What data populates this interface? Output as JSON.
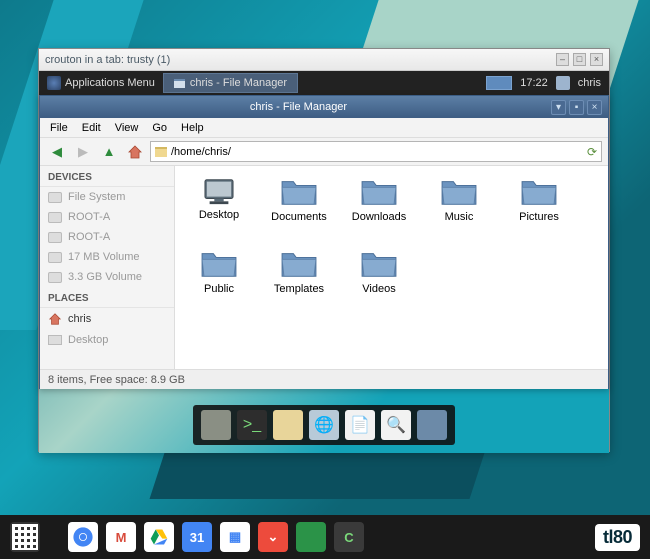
{
  "outer_window": {
    "title": "crouton in a tab: trusty (1)"
  },
  "panel": {
    "appmenu": "Applications Menu",
    "task": "chris - File Manager",
    "clock": "17:22",
    "user": "chris"
  },
  "filemanager": {
    "title": "chris - File Manager",
    "menus": [
      "File",
      "Edit",
      "View",
      "Go",
      "Help"
    ],
    "path": "/home/chris/",
    "sidebar": {
      "devices_head": "DEVICES",
      "places_head": "PLACES",
      "devices": [
        "File System",
        "ROOT-A",
        "ROOT-A",
        "17 MB Volume",
        "3.3 GB Volume"
      ],
      "places": [
        "chris",
        "Desktop"
      ]
    },
    "icons": [
      "Desktop",
      "Documents",
      "Downloads",
      "Music",
      "Pictures",
      "Public",
      "Templates",
      "Videos"
    ],
    "status": "8 items, Free space: 8.9 GB"
  },
  "watermark": "tl80"
}
